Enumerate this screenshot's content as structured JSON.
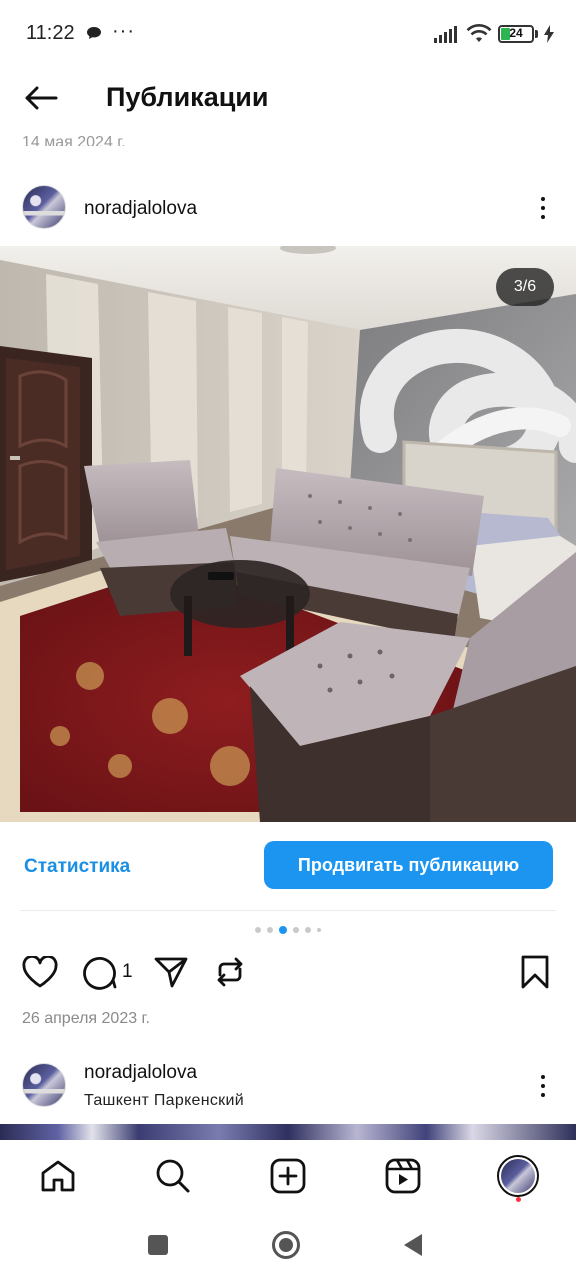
{
  "status_bar": {
    "time": "11:22",
    "dots": "···",
    "battery": "24"
  },
  "header": {
    "title": "Публикации"
  },
  "previous_post_date": "14 мая 2024 г.",
  "post": {
    "username": "noradjalolova",
    "media_counter": "3/6",
    "current_slide": 3,
    "total_slides": 6,
    "statistics_label": "Статистика",
    "promote_label": "Продвигать публикацию",
    "comment_count": "1",
    "date": "26 апреля 2023 г."
  },
  "next_post": {
    "username": "noradjalolova",
    "location": "Ташкент Паркенский"
  },
  "icons": {
    "back": "arrow-left-icon",
    "more": "more-vertical-icon",
    "like": "heart-icon",
    "comment": "comment-icon",
    "share": "send-icon",
    "remix": "remix-icon",
    "save": "bookmark-icon",
    "home": "home-icon",
    "search": "search-icon",
    "create": "plus-square-icon",
    "reels": "reels-icon",
    "profile": "avatar",
    "sys_recent": "square-icon",
    "sys_home": "circle-icon",
    "sys_back": "triangle-back-icon"
  },
  "colors": {
    "accent": "#1b95f0",
    "link": "#1b8fe3",
    "battery_fill": "#2db552",
    "notification": "#ff3040"
  }
}
